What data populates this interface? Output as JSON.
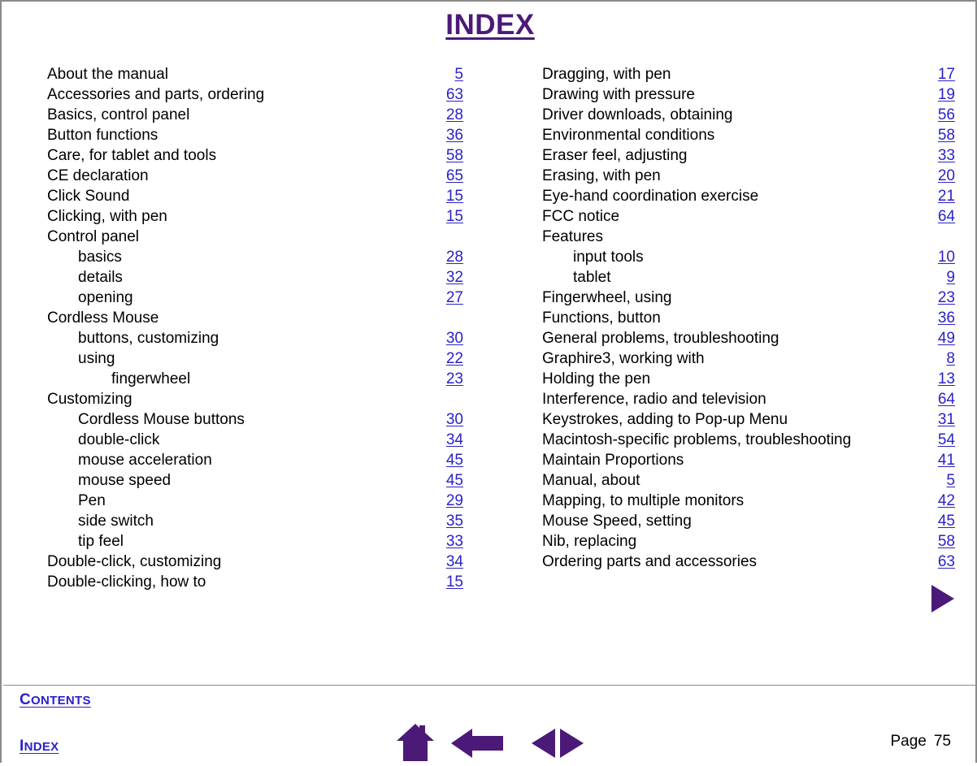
{
  "document": {
    "title": "INDEX",
    "page_label": "Page",
    "page_number": "75"
  },
  "colors": {
    "title": "#4b1a78",
    "link": "#2a22c8",
    "icon": "#4b1a78",
    "text": "#000000",
    "border": "#8a8a8a"
  },
  "columns": {
    "left": [
      {
        "label": "About the manual",
        "page": "5",
        "level": 0
      },
      {
        "label": "Accessories and parts, ordering",
        "page": "63",
        "level": 0
      },
      {
        "label": "Basics, control panel",
        "page": "28",
        "level": 0
      },
      {
        "label": "Button functions",
        "page": "36",
        "level": 0
      },
      {
        "label": "Care, for tablet and tools",
        "page": "58",
        "level": 0
      },
      {
        "label": "CE declaration",
        "page": "65",
        "level": 0
      },
      {
        "label": "Click Sound",
        "page": "15",
        "level": 0
      },
      {
        "label": "Clicking, with pen",
        "page": "15",
        "level": 0
      },
      {
        "label": "Control panel",
        "page": "",
        "level": 0
      },
      {
        "label": "basics",
        "page": "28",
        "level": 1
      },
      {
        "label": "details",
        "page": "32",
        "level": 1
      },
      {
        "label": "opening",
        "page": "27",
        "level": 1
      },
      {
        "label": "Cordless Mouse",
        "page": "",
        "level": 0
      },
      {
        "label": "buttons, customizing",
        "page": "30",
        "level": 1
      },
      {
        "label": "using",
        "page": "22",
        "level": 1
      },
      {
        "label": "fingerwheel",
        "page": "23",
        "level": 2
      },
      {
        "label": "Customizing",
        "page": "",
        "level": 0
      },
      {
        "label": "Cordless Mouse buttons",
        "page": "30",
        "level": 1
      },
      {
        "label": "double-click",
        "page": "34",
        "level": 1
      },
      {
        "label": "mouse acceleration",
        "page": "45",
        "level": 1
      },
      {
        "label": "mouse speed",
        "page": "45",
        "level": 1
      },
      {
        "label": "Pen",
        "page": "29",
        "level": 1
      },
      {
        "label": "side switch",
        "page": "35",
        "level": 1
      },
      {
        "label": "tip feel",
        "page": "33",
        "level": 1
      },
      {
        "label": "Double-click, customizing",
        "page": "34",
        "level": 0
      },
      {
        "label": "Double-clicking, how to",
        "page": "15",
        "level": 0
      }
    ],
    "right": [
      {
        "label": "Dragging, with pen",
        "page": "17",
        "level": 0
      },
      {
        "label": "Drawing with pressure",
        "page": "19",
        "level": 0
      },
      {
        "label": "Driver downloads, obtaining",
        "page": "56",
        "level": 0
      },
      {
        "label": "Environmental conditions",
        "page": "58",
        "level": 0
      },
      {
        "label": "Eraser feel, adjusting",
        "page": "33",
        "level": 0
      },
      {
        "label": "Erasing, with pen",
        "page": "20",
        "level": 0
      },
      {
        "label": "Eye-hand coordination exercise",
        "page": "21",
        "level": 0
      },
      {
        "label": "FCC notice",
        "page": "64",
        "level": 0
      },
      {
        "label": "Features",
        "page": "",
        "level": 0
      },
      {
        "label": "input tools",
        "page": "10",
        "level": 1
      },
      {
        "label": "tablet",
        "page": "9",
        "level": 1
      },
      {
        "label": "Fingerwheel, using",
        "page": "23",
        "level": 0
      },
      {
        "label": "Functions, button",
        "page": "36",
        "level": 0
      },
      {
        "label": "General problems, troubleshooting",
        "page": "49",
        "level": 0
      },
      {
        "label": "Graphire3, working with",
        "page": "8",
        "level": 0
      },
      {
        "label": "Holding the pen",
        "page": "13",
        "level": 0
      },
      {
        "label": "Interference, radio and television",
        "page": "64",
        "level": 0
      },
      {
        "label": "Keystrokes, adding to Pop-up Menu",
        "page": "31",
        "level": 0
      },
      {
        "label": "Macintosh-specific problems, troubleshooting",
        "page": "54",
        "level": 0
      },
      {
        "label": "Maintain Proportions",
        "page": "41",
        "level": 0
      },
      {
        "label": "Manual, about",
        "page": "5",
        "level": 0
      },
      {
        "label": "Mapping, to multiple monitors",
        "page": "42",
        "level": 0
      },
      {
        "label": "Mouse Speed, setting",
        "page": "45",
        "level": 0
      },
      {
        "label": "Nib, replacing",
        "page": "58",
        "level": 0
      },
      {
        "label": "Ordering parts and accessories",
        "page": "63",
        "level": 0
      }
    ]
  },
  "footer": {
    "contents_link": {
      "first": "C",
      "rest": "ONTENTS"
    },
    "index_link": {
      "first": "I",
      "rest": "NDEX"
    },
    "icons": [
      {
        "name": "home-icon",
        "title": "Home"
      },
      {
        "name": "back-icon",
        "title": "Back"
      },
      {
        "name": "prevnext-icon",
        "title": "Previous / Next page"
      }
    ]
  },
  "next_page_arrow": {
    "name": "next-page-arrow",
    "title": "Next page"
  }
}
